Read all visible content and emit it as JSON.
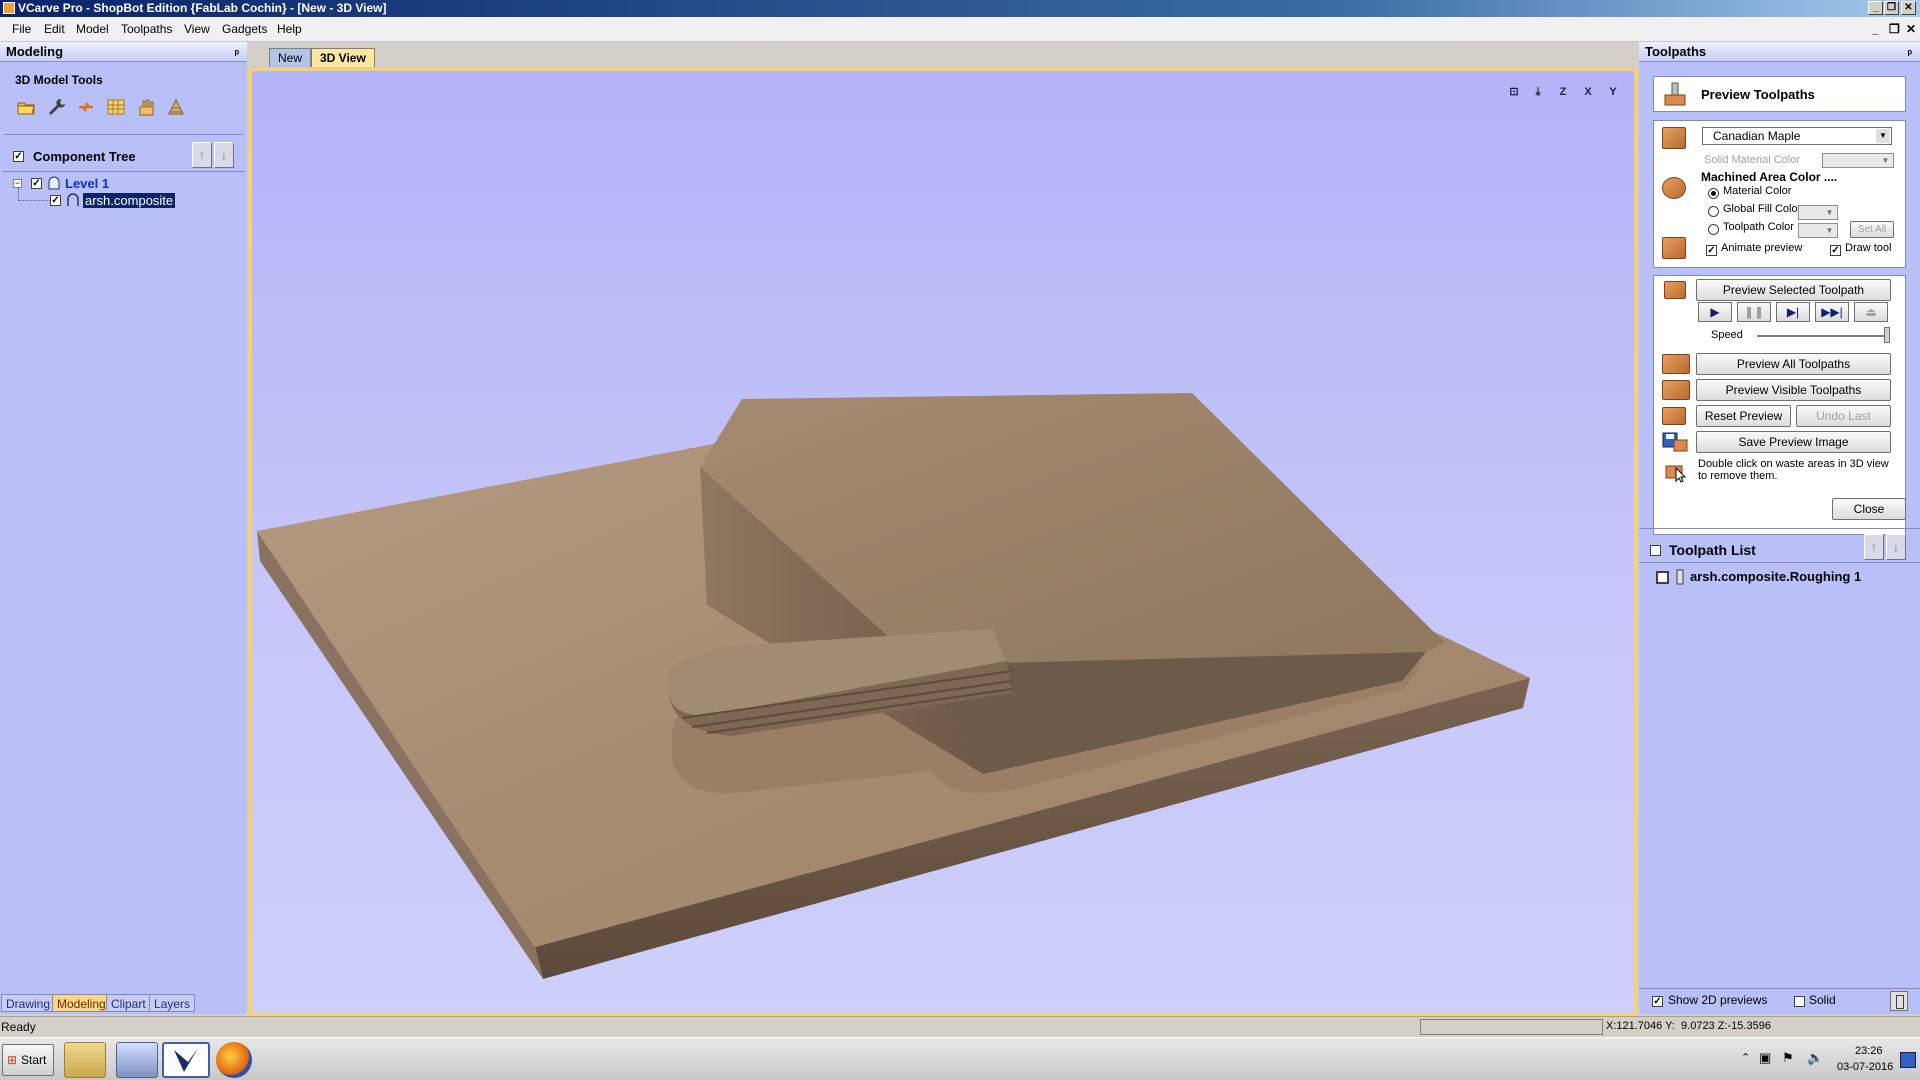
{
  "window": {
    "title": "VCarve Pro - ShopBot Edition {FabLab Cochin} - [New - 3D View]",
    "controls": [
      "_",
      "❐",
      "✕"
    ],
    "mdi_controls": [
      "_",
      "❐",
      "✕"
    ]
  },
  "menu": [
    "File",
    "Edit",
    "Model",
    "Toolpaths",
    "View",
    "Gadgets",
    "Help"
  ],
  "left_panel": {
    "title": "Modeling",
    "pin": "ᵖ",
    "tools_heading": "3D Model Tools",
    "tool_icons": [
      "open-folder-icon",
      "wrench-icon",
      "transform-arrows-icon",
      "grid-icon",
      "hand-sculpt-icon",
      "cone-icon"
    ],
    "component_tree_label": "Component Tree",
    "up_arrow": "↑",
    "down_arrow": "↓",
    "tree": {
      "expander": "−",
      "level_label": "Level 1",
      "item_label": "arsh.composite"
    },
    "bottom_tabs": [
      "Drawing",
      "Modeling",
      "Clipart",
      "Layers"
    ]
  },
  "view": {
    "tabs": [
      "New",
      "3D View"
    ],
    "icons": [
      {
        "name": "zoom-fit-icon",
        "glyph": "⊡"
      },
      {
        "name": "iso-view-icon",
        "glyph": "⤓"
      },
      {
        "name": "view-z-icon",
        "glyph": "Z"
      },
      {
        "name": "view-x-icon",
        "glyph": "X"
      },
      {
        "name": "view-y-icon",
        "glyph": "Y"
      }
    ],
    "colors": {
      "background": "#b9b9f8",
      "wood": "#a88a6e"
    }
  },
  "right_panel": {
    "title": "Toolpaths",
    "pin": "ᵖ",
    "preview_title": "Preview Toolpaths",
    "material": "Canadian Maple",
    "solid_material_color": "Solid Material Color",
    "machined_area_heading": "Machined Area Color ....",
    "radio_options": [
      "Material Color",
      "Global Fill Color",
      "Toolpath Color"
    ],
    "set_all": "Set All",
    "animate_preview": "Animate preview",
    "draw_tool": "Draw tool",
    "preview_selected": "Preview Selected Toolpath",
    "media_buttons": [
      "▶",
      "❚❚",
      "▶|",
      "▶▶|",
      "⏏"
    ],
    "speed_label": "Speed",
    "preview_all": "Preview All Toolpaths",
    "preview_visible": "Preview Visible Toolpaths",
    "reset_preview": "Reset Preview",
    "undo_last": "Undo Last",
    "save_preview": "Save Preview Image",
    "hint": "Double click on waste areas in 3D view to remove them.",
    "close": "Close",
    "toolpath_list_label": "Toolpath List",
    "toolpath_item": "arsh.composite.Roughing 1",
    "show_2d": "Show 2D previews",
    "solid": "Solid",
    "checks": {
      "animate": true,
      "draw_tool": true,
      "show_2d": true,
      "solid": false,
      "toolpath_item": false
    }
  },
  "status": {
    "left": "Ready",
    "coords": "X:121.7046 Y:  9.0723 Z:-15.3596"
  },
  "taskbar": {
    "start": "Start",
    "time": "23:26",
    "date": "03-07-2016",
    "tray": [
      "⌃",
      "▣",
      "⚑",
      "🔈"
    ]
  }
}
